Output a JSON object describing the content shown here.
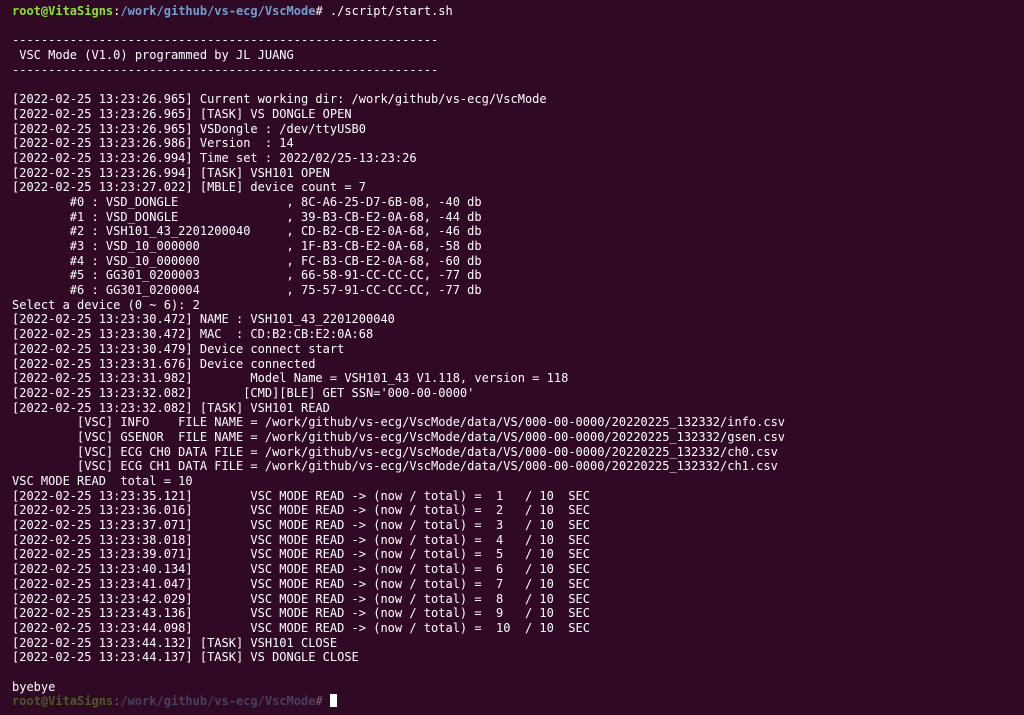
{
  "terminal": {
    "prompt": {
      "user_host": "root@VitaSigns",
      "separator": ":",
      "path": "/work/github/vs-ecg/VscMode",
      "symbol": "# ",
      "command": "./script/start.sh"
    },
    "lines": [
      "",
      "-----------------------------------------------------------",
      " VSC Mode (V1.0) programmed by JL JUANG",
      "-----------------------------------------------------------",
      "",
      "[2022-02-25 13:23:26.965] Current working dir: /work/github/vs-ecg/VscMode",
      "[2022-02-25 13:23:26.965] [TASK] VS DONGLE OPEN",
      "[2022-02-25 13:23:26.965] VSDongle : /dev/ttyUSB0",
      "[2022-02-25 13:23:26.986] Version  : 14",
      "[2022-02-25 13:23:26.994] Time set : 2022/02/25-13:23:26",
      "[2022-02-25 13:23:26.994] [TASK] VSH101 OPEN",
      "[2022-02-25 13:23:27.022] [MBLE] device count = 7",
      "        #0 : VSD_DONGLE               , 8C-A6-25-D7-6B-08, -40 db",
      "        #1 : VSD_DONGLE               , 39-B3-CB-E2-0A-68, -44 db",
      "        #2 : VSH101_43_2201200040     , CD-B2-CB-E2-0A-68, -46 db",
      "        #3 : VSD_10_000000            , 1F-B3-CB-E2-0A-68, -58 db",
      "        #4 : VSD_10_000000            , FC-B3-CB-E2-0A-68, -60 db",
      "        #5 : GG301_0200003            , 66-58-91-CC-CC-CC, -77 db",
      "        #6 : GG301_0200004            , 75-57-91-CC-CC-CC, -77 db",
      "Select a device (0 ~ 6): 2",
      "[2022-02-25 13:23:30.472] NAME : VSH101_43_2201200040",
      "[2022-02-25 13:23:30.472] MAC  : CD:B2:CB:E2:0A:68",
      "[2022-02-25 13:23:30.479] Device connect start",
      "[2022-02-25 13:23:31.676] Device connected",
      "[2022-02-25 13:23:31.982]        Model Name = VSH101_43 V1.118, version = 118",
      "[2022-02-25 13:23:32.082]       [CMD][BLE] GET SSN='000-00-0000'",
      "[2022-02-25 13:23:32.082] [TASK] VSH101 READ",
      "         [VSC] INFO    FILE NAME = /work/github/vs-ecg/VscMode/data/VS/000-00-0000/20220225_132332/info.csv",
      "         [VSC] GSENOR  FILE NAME = /work/github/vs-ecg/VscMode/data/VS/000-00-0000/20220225_132332/gsen.csv",
      "         [VSC] ECG CH0 DATA FILE = /work/github/vs-ecg/VscMode/data/VS/000-00-0000/20220225_132332/ch0.csv",
      "         [VSC] ECG CH1 DATA FILE = /work/github/vs-ecg/VscMode/data/VS/000-00-0000/20220225_132332/ch1.csv",
      "VSC MODE READ  total = 10",
      "[2022-02-25 13:23:35.121]        VSC MODE READ -> (now / total) =  1   / 10  SEC",
      "[2022-02-25 13:23:36.016]        VSC MODE READ -> (now / total) =  2   / 10  SEC",
      "[2022-02-25 13:23:37.071]        VSC MODE READ -> (now / total) =  3   / 10  SEC",
      "[2022-02-25 13:23:38.018]        VSC MODE READ -> (now / total) =  4   / 10  SEC",
      "[2022-02-25 13:23:39.071]        VSC MODE READ -> (now / total) =  5   / 10  SEC",
      "[2022-02-25 13:23:40.134]        VSC MODE READ -> (now / total) =  6   / 10  SEC",
      "[2022-02-25 13:23:41.047]        VSC MODE READ -> (now / total) =  7   / 10  SEC",
      "[2022-02-25 13:23:42.029]        VSC MODE READ -> (now / total) =  8   / 10  SEC",
      "[2022-02-25 13:23:43.136]        VSC MODE READ -> (now / total) =  9   / 10  SEC",
      "[2022-02-25 13:23:44.098]        VSC MODE READ -> (now / total) =  10  / 10  SEC",
      "[2022-02-25 13:23:44.132] [TASK] VSH101 CLOSE",
      "[2022-02-25 13:23:44.137] [TASK] VS DONGLE CLOSE",
      "",
      "byebye"
    ],
    "colors": {
      "background": "#300a24",
      "text": "#ffffff",
      "user_host": "#8ae234",
      "path": "#729fcf"
    }
  }
}
